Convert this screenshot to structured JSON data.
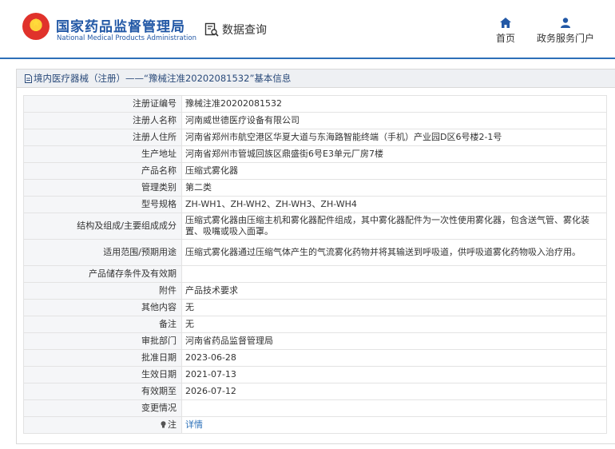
{
  "header": {
    "org_name_cn": "国家药品监督管理局",
    "org_name_en": "National Medical Products Administration",
    "data_query": "数据查询",
    "nav": [
      {
        "label": "首页",
        "icon": "home-icon"
      },
      {
        "label": "政务服务门户",
        "icon": "user-icon"
      }
    ]
  },
  "panel": {
    "title": "境内医疗器械（注册）——“豫械注准20202081532”基本信息"
  },
  "rows": [
    {
      "label": "注册证编号",
      "value": "豫械注准20202081532"
    },
    {
      "label": "注册人名称",
      "value": "河南威世德医疗设备有限公司"
    },
    {
      "label": "注册人住所",
      "value": "河南省郑州市航空港区华夏大道与东海路智能终端（手机）产业园D区6号楼2-1号"
    },
    {
      "label": "生产地址",
      "value": "河南省郑州市管城回族区鼎盛街6号E3单元厂房7楼"
    },
    {
      "label": "产品名称",
      "value": "压缩式雾化器"
    },
    {
      "label": "管理类别",
      "value": "第二类"
    },
    {
      "label": "型号规格",
      "value": "ZH-WH1、ZH-WH2、ZH-WH3、ZH-WH4"
    },
    {
      "label": "结构及组成/主要组成成分",
      "value": "压缩式雾化器由压缩主机和雾化器配件组成，其中雾化器配件为一次性使用雾化器，包含送气管、雾化装置、吸嘴或吸入面罩。"
    },
    {
      "label": "适用范围/预期用途",
      "value": "压缩式雾化器通过压缩气体产生的气流雾化药物并将其输送到呼吸道，供呼吸道雾化药物吸入治疗用。"
    },
    {
      "label": "产品储存条件及有效期",
      "value": ""
    },
    {
      "label": "附件",
      "value": "产品技术要求"
    },
    {
      "label": "其他内容",
      "value": "无"
    },
    {
      "label": "备注",
      "value": "无"
    },
    {
      "label": "审批部门",
      "value": "河南省药品监督管理局"
    },
    {
      "label": "批准日期",
      "value": "2023-06-28"
    },
    {
      "label": "生效日期",
      "value": "2021-07-13"
    },
    {
      "label": "有效期至",
      "value": "2026-07-12"
    },
    {
      "label": "变更情况",
      "value": ""
    }
  ],
  "note": {
    "label": "注",
    "link": "详情",
    "icon": "bulb-icon"
  }
}
